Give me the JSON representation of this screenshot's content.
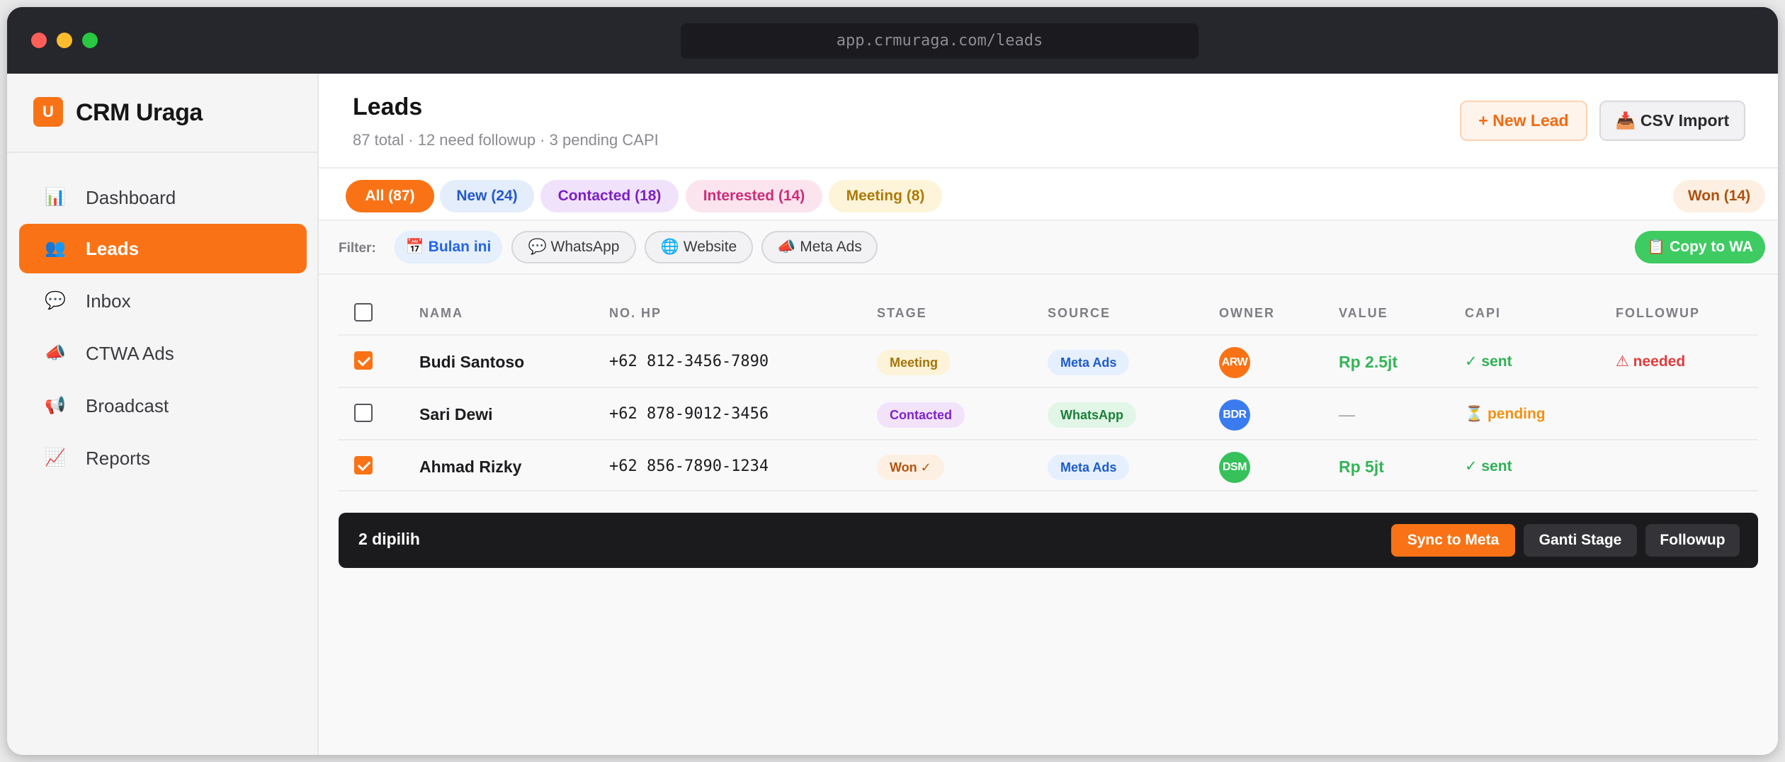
{
  "browser": {
    "url": "app.crmuraga.com/leads"
  },
  "brand": {
    "logo_letter": "U",
    "name": "CRM Uraga"
  },
  "sidebar": {
    "items": [
      {
        "icon": "📊",
        "icon_name": "chart-icon",
        "label": "Dashboard",
        "active": false
      },
      {
        "icon": "👥",
        "icon_name": "people-icon",
        "label": "Leads",
        "active": true
      },
      {
        "icon": "💬",
        "icon_name": "speech-bubble-icon",
        "label": "Inbox",
        "active": false
      },
      {
        "icon": "📣",
        "icon_name": "megaphone-icon",
        "label": "CTWA Ads",
        "active": false
      },
      {
        "icon": "📢",
        "icon_name": "loudspeaker-icon",
        "label": "Broadcast",
        "active": false
      },
      {
        "icon": "📈",
        "icon_name": "trend-chart-icon",
        "label": "Reports",
        "active": false
      }
    ]
  },
  "header": {
    "title": "Leads",
    "subtitle": "87 total · 12 need followup · 3 pending CAPI",
    "new_lead_label": "+ New Lead",
    "csv_import_label": "📥 CSV Import"
  },
  "stage_tabs": [
    {
      "label": "All (87)",
      "active": true
    },
    {
      "label": "New (24)",
      "active": false
    },
    {
      "label": "Contacted (18)",
      "active": false
    },
    {
      "label": "Interested (14)",
      "active": false
    },
    {
      "label": "Meeting (8)",
      "active": false
    },
    {
      "label": "Won (14)",
      "active": false
    }
  ],
  "filters": {
    "label": "Filter:",
    "chips": [
      {
        "label": "📅 Bulan ini",
        "selected": true
      },
      {
        "label": "💬 WhatsApp",
        "selected": false
      },
      {
        "label": "🌐 Website",
        "selected": false
      },
      {
        "label": "📣 Meta Ads",
        "selected": false
      }
    ],
    "copy_to_wa_label": "📋 Copy to WA"
  },
  "table": {
    "columns": [
      "NAMA",
      "NO. HP",
      "STAGE",
      "SOURCE",
      "OWNER",
      "VALUE",
      "CAPI",
      "FOLLOWUP"
    ],
    "rows": [
      {
        "checked": true,
        "name": "Budi Santoso",
        "phone": "+62 812-3456-7890",
        "stage": "Meeting",
        "source": "Meta Ads",
        "owner": "ARW",
        "owner_color": "#f97316",
        "value": "Rp 2.5jt",
        "capi": "✓ sent",
        "capi_color": "#2fb152",
        "followup": "⚠ needed"
      },
      {
        "checked": false,
        "name": "Sari Dewi",
        "phone": "+62 878-9012-3456",
        "stage": "Contacted",
        "source": "WhatsApp",
        "owner": "BDR",
        "owner_color": "#3b7bf0",
        "value": "—",
        "capi": "⏳ pending",
        "capi_color": "#f29111",
        "followup": ""
      },
      {
        "checked": true,
        "name": "Ahmad Rizky",
        "phone": "+62 856-7890-1234",
        "stage": "Won ✓",
        "source": "Meta Ads",
        "owner": "DSM",
        "owner_color": "#36c15a",
        "value": "Rp 5jt",
        "capi": "✓ sent",
        "capi_color": "#2fb152",
        "followup": ""
      }
    ]
  },
  "bulk_bar": {
    "count_label": "2 dipilih",
    "sync_label": "Sync to Meta",
    "stage_label": "Ganti Stage",
    "followup_label": "Followup"
  }
}
